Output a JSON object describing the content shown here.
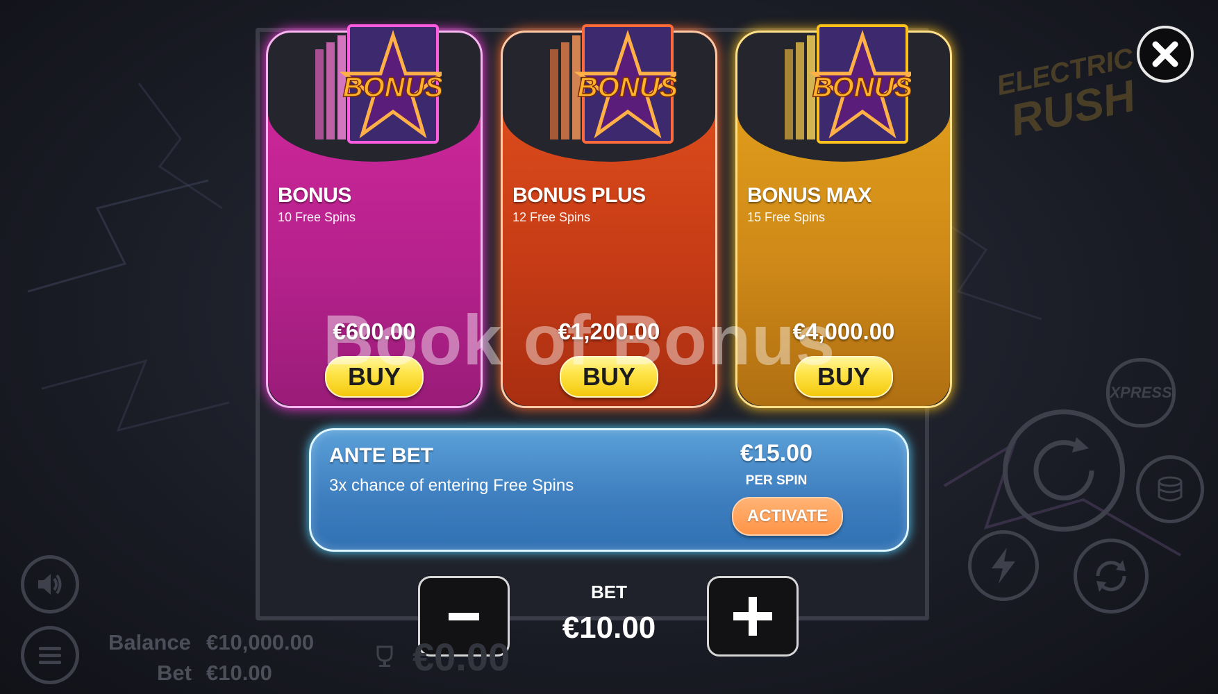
{
  "watermark": "Book of Bonus",
  "logo": {
    "line1": "ELECTRIC",
    "line2": "RUSH"
  },
  "cards": [
    {
      "title": "BONUS",
      "subtitle": "10 Free Spins",
      "price": "€600.00",
      "buy_label": "BUY",
      "image_text": "BONUS",
      "color": "#c8258f"
    },
    {
      "title": "BONUS PLUS",
      "subtitle": "12 Free Spins",
      "price": "€1,200.00",
      "buy_label": "BUY",
      "image_text": "BONUS",
      "color": "#d4461a"
    },
    {
      "title": "BONUS MAX",
      "subtitle": "15 Free Spins",
      "price": "€4,000.00",
      "buy_label": "BUY",
      "image_text": "BONUS",
      "color": "#dc9a1a"
    }
  ],
  "ante": {
    "title": "ANTE BET",
    "description": "3x chance of entering Free Spins",
    "price": "€15.00",
    "per_spin": "PER SPIN",
    "activate_label": "ACTIVATE"
  },
  "bet": {
    "label": "BET",
    "value": "€10.00",
    "decrease_icon": "minus-icon",
    "increase_icon": "plus-icon"
  },
  "footer": {
    "balance_label": "Balance",
    "balance_value": "€10,000.00",
    "bet_label": "Bet",
    "bet_value": "€10.00",
    "win_value": "€0.00"
  },
  "side_controls": {
    "xpress_label": "XPRESS"
  },
  "colors": {
    "ante_border": "#dff6ff",
    "buy_button": "#ffe54a",
    "activate_button": "#ff9447"
  }
}
